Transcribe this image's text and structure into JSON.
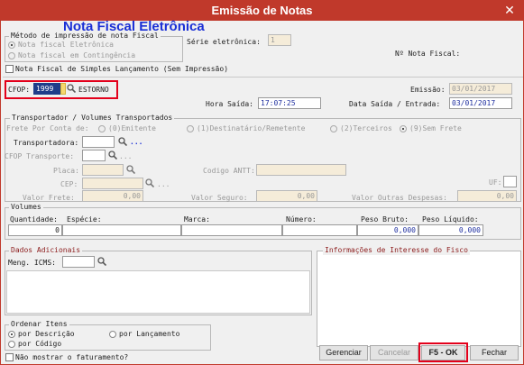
{
  "window": {
    "title": "Emissão de Notas",
    "close_glyph": "✕"
  },
  "header": {
    "brand_title": "Nota Fiscal Eletrônica",
    "metodo_label": "Método de impressão de nota Fiscal",
    "opt_eletronica": "Nota fiscal Eletrônica",
    "opt_contingencia": "Nota fiscal em Contingência",
    "serie_label": "Série eletrônica:",
    "serie_value": "1",
    "nf_label": "Nº Nota Fiscal:",
    "simples_label": "Nota Fiscal de Simples Lançamento (Sem Impressão)"
  },
  "cfop": {
    "label": "CFOP:",
    "value": "1999",
    "desc": "ESTORNO",
    "more": "..."
  },
  "dates": {
    "emissao_label": "Emissão:",
    "emissao_value": "03/01/2017",
    "hora_label": "Hora Saída:",
    "hora_value": "17:07:25",
    "data_label": "Data Saída / Entrada:",
    "data_value": "03/01/2017"
  },
  "transporte": {
    "title": "Transportador / Volumes Transportados",
    "frete_label": "Frete Por Conta de:",
    "opt0": "(0)Emitente",
    "opt1": "(1)Destinatário/Remetente",
    "opt2": "(2)Terceiros",
    "opt9": "(9)Sem Frete",
    "transportadora_label": "Transportadora:",
    "cfop_transp_label": "CFOP Transporte:",
    "placa_label": "Placa:",
    "antt_label": "Codigo ANTT:",
    "cep_label": "CEP:",
    "uf_label": "UF:",
    "valor_frete_label": "Valor Frete:",
    "valor_frete": "0,00",
    "valor_seguro_label": "Valor Seguro:",
    "valor_seguro": "0,00",
    "outras_label": "Valor Outras Despesas:",
    "outras": "0,00",
    "more": "..."
  },
  "volumes": {
    "title": "Volumes",
    "qtd_label": "Quantidade:",
    "especie_label": "Espécie:",
    "marca_label": "Marca:",
    "numero_label": "Número:",
    "bruto_label": "Peso Bruto:",
    "liquido_label": "Peso Líquido:",
    "qtd": "0",
    "bruto": "0,000",
    "liquido": "0,000"
  },
  "adicionais": {
    "title": "Dados Adicionais",
    "icms_label": "Meng. ICMS:",
    "fisco_title": "Informações de Interesse do Fisco"
  },
  "ordenar": {
    "title": "Ordenar Itens",
    "opt_desc": "por Descrição",
    "opt_lanc": "por Lançamento",
    "opt_cod": "por Código"
  },
  "footer": {
    "nao_mostrar": "Não mostrar o faturamento?",
    "gerenciar": "Gerenciar",
    "cancelar": "Cancelar",
    "ok": "F5 - OK",
    "fechar": "Fechar"
  },
  "colors": {
    "title_bar": "#c0392b",
    "highlight_box": "#e3001b",
    "brand_blue": "#1a2fd6"
  }
}
